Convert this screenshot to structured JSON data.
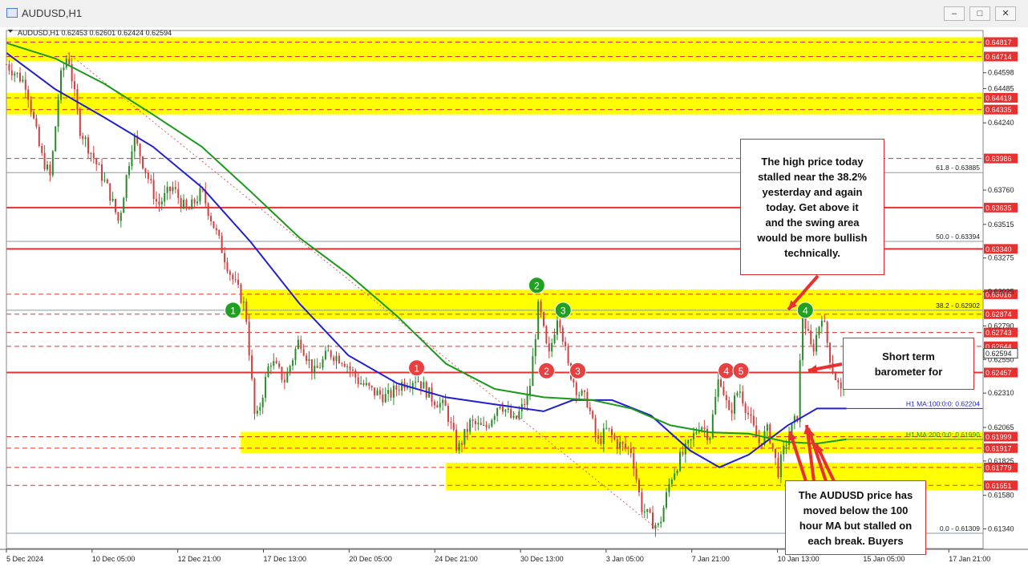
{
  "window": {
    "title": "AUDUSD,H1",
    "min_label": "–",
    "max_label": "□",
    "close_label": "✕"
  },
  "colors": {
    "red_line": "#e83030",
    "zone": "#ffff00",
    "ma100": "#2020d0",
    "ma200": "#1a9a1a",
    "candle_up": "#2a8a2a",
    "candle_down": "#d04040",
    "marker_green": "#22a022",
    "marker_red": "#e84040"
  },
  "chart_data": {
    "type": "candlestick",
    "symbol_info": "AUDUSD,H1  0.62453 0.62601 0.62424 0.62594",
    "ylim": [
      0.612,
      0.649
    ],
    "price_ticks": [
      "0.64598",
      "0.64485",
      "0.64240",
      "0.63760",
      "0.63515",
      "0.63275",
      "0.63035",
      "0.62790",
      "0.62550",
      "0.62310",
      "0.62065",
      "0.61825",
      "0.61580",
      "0.61340"
    ],
    "x_ticks": [
      "5 Dec 2024",
      "10 Dec 05:00",
      "12 Dec 21:00",
      "17 Dec 13:00",
      "20 Dec 05:00",
      "24 Dec 21:00",
      "30 Dec 13:00",
      "3 Jan 05:00",
      "7 Jan 21:00",
      "10 Jan 13:00",
      "15 Jan 05:00",
      "17 Jan 21:00"
    ],
    "red_levels": [
      {
        "price": 0.64817,
        "label": "0.64817"
      },
      {
        "price": 0.64714,
        "label": "0.64714"
      },
      {
        "price": 0.64419,
        "label": "0.64419"
      },
      {
        "price": 0.64335,
        "label": "0.64335"
      },
      {
        "price": 0.63986,
        "label": "0.63986"
      },
      {
        "price": 0.63635,
        "label": "0.63635"
      },
      {
        "price": 0.6334,
        "label": "0.63340"
      },
      {
        "price": 0.63016,
        "label": "0.63016"
      },
      {
        "price": 0.62874,
        "label": "0.62874"
      },
      {
        "price": 0.62743,
        "label": "0.62743"
      },
      {
        "price": 0.62644,
        "label": "0.62644"
      },
      {
        "price": 0.62457,
        "label": "0.62457"
      },
      {
        "price": 0.61999,
        "label": "0.61999"
      },
      {
        "price": 0.61917,
        "label": "0.61917"
      },
      {
        "price": 0.61779,
        "label": "0.61779"
      },
      {
        "price": 0.61651,
        "label": "0.61651"
      }
    ],
    "solid_levels": [
      0.63635,
      0.6334,
      0.62457
    ],
    "zones": [
      {
        "from": 0.64714,
        "to": 0.64817,
        "start": 0.0
      },
      {
        "from": 0.64335,
        "to": 0.64419,
        "start": 0.0
      },
      {
        "from": 0.62874,
        "to": 0.63016,
        "start": 0.24
      },
      {
        "from": 0.61917,
        "to": 0.61999,
        "start": 0.24
      },
      {
        "from": 0.61651,
        "to": 0.61779,
        "start": 0.45
      }
    ],
    "fib_levels": [
      {
        "price": 0.63885,
        "label": "61.8 - 0.63885"
      },
      {
        "price": 0.63394,
        "label": "50.0 - 0.63394"
      },
      {
        "price": 0.62902,
        "label": "38.2 - 0.62902"
      },
      {
        "price": 0.61309,
        "label": "0.0 - 0.61309"
      }
    ],
    "current_price": {
      "price": 0.62594,
      "label": "0.62594"
    },
    "ma100": {
      "label": "H1 MA:100:0:0: 0.62204",
      "points": [
        [
          0.0,
          0.6474
        ],
        [
          0.05,
          0.6448
        ],
        [
          0.1,
          0.6428
        ],
        [
          0.15,
          0.6407
        ],
        [
          0.2,
          0.6378
        ],
        [
          0.25,
          0.6339
        ],
        [
          0.3,
          0.6295
        ],
        [
          0.35,
          0.6258
        ],
        [
          0.4,
          0.6238
        ],
        [
          0.45,
          0.6228
        ],
        [
          0.5,
          0.6223
        ],
        [
          0.55,
          0.6218
        ],
        [
          0.58,
          0.6226
        ],
        [
          0.62,
          0.6226
        ],
        [
          0.66,
          0.6215
        ],
        [
          0.7,
          0.619
        ],
        [
          0.73,
          0.6178
        ],
        [
          0.76,
          0.6187
        ],
        [
          0.8,
          0.6208
        ],
        [
          0.83,
          0.622
        ],
        [
          0.86,
          0.622
        ]
      ]
    },
    "ma200": {
      "label": "H1 MA:200:0:0: 0.61990",
      "points": [
        [
          0.0,
          0.6481
        ],
        [
          0.05,
          0.647
        ],
        [
          0.1,
          0.6452
        ],
        [
          0.15,
          0.643
        ],
        [
          0.2,
          0.6407
        ],
        [
          0.25,
          0.6375
        ],
        [
          0.3,
          0.6342
        ],
        [
          0.35,
          0.6316
        ],
        [
          0.4,
          0.6286
        ],
        [
          0.45,
          0.6252
        ],
        [
          0.5,
          0.6234
        ],
        [
          0.55,
          0.6228
        ],
        [
          0.6,
          0.6226
        ],
        [
          0.64,
          0.622
        ],
        [
          0.68,
          0.6208
        ],
        [
          0.72,
          0.6203
        ],
        [
          0.76,
          0.6202
        ],
        [
          0.8,
          0.6196
        ],
        [
          0.83,
          0.6195
        ],
        [
          0.86,
          0.6198
        ]
      ]
    },
    "price_path": [
      [
        0.0,
        0.6466
      ],
      [
        0.02,
        0.6452
      ],
      [
        0.035,
        0.6402
      ],
      [
        0.045,
        0.6385
      ],
      [
        0.055,
        0.6455
      ],
      [
        0.063,
        0.6474
      ],
      [
        0.075,
        0.642
      ],
      [
        0.09,
        0.6398
      ],
      [
        0.105,
        0.6375
      ],
      [
        0.115,
        0.6353
      ],
      [
        0.13,
        0.6415
      ],
      [
        0.14,
        0.6395
      ],
      [
        0.155,
        0.6365
      ],
      [
        0.17,
        0.6378
      ],
      [
        0.185,
        0.636
      ],
      [
        0.2,
        0.6375
      ],
      [
        0.215,
        0.6345
      ],
      [
        0.23,
        0.6315
      ],
      [
        0.24,
        0.63
      ],
      [
        0.245,
        0.629
      ],
      [
        0.255,
        0.6208
      ],
      [
        0.27,
        0.6255
      ],
      [
        0.285,
        0.624
      ],
      [
        0.3,
        0.627
      ],
      [
        0.315,
        0.6245
      ],
      [
        0.33,
        0.626
      ],
      [
        0.345,
        0.6255
      ],
      [
        0.36,
        0.624
      ],
      [
        0.375,
        0.6232
      ],
      [
        0.39,
        0.6228
      ],
      [
        0.405,
        0.6238
      ],
      [
        0.42,
        0.6242
      ],
      [
        0.435,
        0.6228
      ],
      [
        0.45,
        0.622
      ],
      [
        0.462,
        0.619
      ],
      [
        0.475,
        0.621
      ],
      [
        0.49,
        0.6205
      ],
      [
        0.505,
        0.6225
      ],
      [
        0.52,
        0.621
      ],
      [
        0.535,
        0.623
      ],
      [
        0.545,
        0.6295
      ],
      [
        0.555,
        0.6255
      ],
      [
        0.565,
        0.629
      ],
      [
        0.575,
        0.625
      ],
      [
        0.585,
        0.6232
      ],
      [
        0.595,
        0.6225
      ],
      [
        0.605,
        0.6195
      ],
      [
        0.615,
        0.6205
      ],
      [
        0.625,
        0.6195
      ],
      [
        0.64,
        0.619
      ],
      [
        0.65,
        0.615
      ],
      [
        0.66,
        0.614
      ],
      [
        0.668,
        0.6135
      ],
      [
        0.68,
        0.617
      ],
      [
        0.69,
        0.6185
      ],
      [
        0.7,
        0.6195
      ],
      [
        0.71,
        0.621
      ],
      [
        0.72,
        0.62
      ],
      [
        0.73,
        0.6245
      ],
      [
        0.74,
        0.6215
      ],
      [
        0.75,
        0.6235
      ],
      [
        0.76,
        0.6215
      ],
      [
        0.77,
        0.6195
      ],
      [
        0.78,
        0.6205
      ],
      [
        0.79,
        0.6175
      ],
      [
        0.8,
        0.62
      ],
      [
        0.81,
        0.6215
      ],
      [
        0.815,
        0.6288
      ],
      [
        0.825,
        0.626
      ],
      [
        0.835,
        0.6288
      ],
      [
        0.845,
        0.625
      ],
      [
        0.855,
        0.623
      ],
      [
        0.86,
        0.6262
      ]
    ],
    "markers": [
      {
        "label": "1",
        "color": "green",
        "x": 0.232,
        "price": 0.62902
      },
      {
        "label": "2",
        "color": "green",
        "x": 0.543,
        "price": 0.6308
      },
      {
        "label": "3",
        "color": "green",
        "x": 0.57,
        "price": 0.62902
      },
      {
        "label": "4",
        "color": "green",
        "x": 0.818,
        "price": 0.62902
      },
      {
        "label": "1",
        "color": "red",
        "x": 0.42,
        "price": 0.6249
      },
      {
        "label": "2",
        "color": "red",
        "x": 0.553,
        "price": 0.6247
      },
      {
        "label": "3",
        "color": "red",
        "x": 0.585,
        "price": 0.6247
      },
      {
        "label": "4",
        "color": "red",
        "x": 0.737,
        "price": 0.6247
      },
      {
        "label": "5",
        "color": "red",
        "x": 0.752,
        "price": 0.6247
      }
    ]
  },
  "callouts": {
    "top": "The high price today\nstalled near the 38.2%\nyesterday and again\ntoday.  Get above it\nand the swing area\nwould be more bullish\ntechnically.",
    "middle": "Short term\nbarometer for",
    "bottom": "The AUDUSD price has\nmoved below the 100\nhour MA but stalled on\neach break. Buyers"
  }
}
